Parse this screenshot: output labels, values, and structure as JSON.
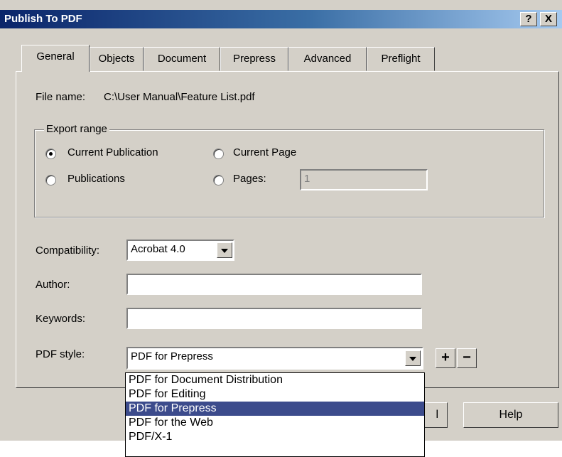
{
  "window": {
    "title": "Publish To PDF",
    "help_glyph": "?",
    "close_glyph": "X"
  },
  "tabs": [
    {
      "label": "General",
      "active": true
    },
    {
      "label": "Objects"
    },
    {
      "label": "Document"
    },
    {
      "label": "Prepress"
    },
    {
      "label": "Advanced"
    },
    {
      "label": "Preflight"
    }
  ],
  "general": {
    "file_name_label": "File name:",
    "file_name_value": "C:\\User Manual\\Feature List.pdf",
    "export_range": {
      "legend": "Export range",
      "options": [
        {
          "label": "Current Publication",
          "selected": true
        },
        {
          "label": "Current Page",
          "selected": false
        },
        {
          "label": "Publications",
          "selected": false
        },
        {
          "label": "Pages:",
          "selected": false
        }
      ],
      "pages_value": "1"
    },
    "compatibility": {
      "label": "Compatibility:",
      "value": "Acrobat 4.0"
    },
    "author": {
      "label": "Author:",
      "value": ""
    },
    "keywords": {
      "label": "Keywords:",
      "value": ""
    },
    "pdf_style": {
      "label": "PDF style:",
      "value": "PDF for Prepress",
      "add_glyph": "+",
      "remove_glyph": "−",
      "options": [
        {
          "label": "PDF for Document Distribution"
        },
        {
          "label": "PDF for Editing"
        },
        {
          "label": "PDF for Prepress",
          "selected": true
        },
        {
          "label": "PDF for the Web"
        },
        {
          "label": "PDF/X-1"
        }
      ]
    }
  },
  "footer": {
    "cancel_fragment": "l",
    "help_label": "Help"
  }
}
